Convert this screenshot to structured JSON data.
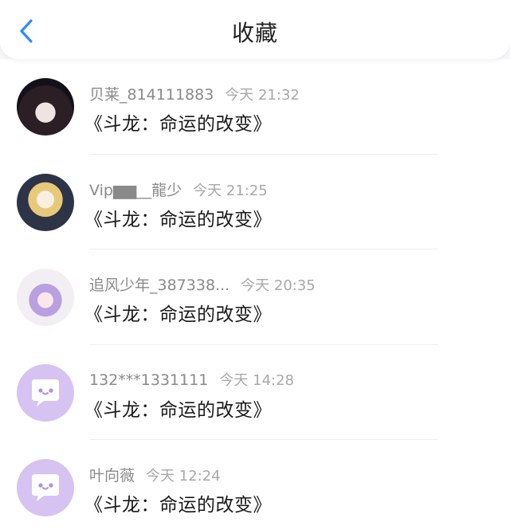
{
  "header": {
    "title": "收藏"
  },
  "items": [
    {
      "username": "贝莱_814111883",
      "time": "今天 21:32",
      "message": "《斗龙：命运的改变》",
      "avatar_icon": "user-avatar-photo"
    },
    {
      "username": "Vip▆▆__龍少",
      "time": "今天 21:25",
      "message": "《斗龙：命运的改变》",
      "avatar_icon": "user-avatar-photo"
    },
    {
      "username": "追风少年_387338...",
      "time": "今天 20:35",
      "message": "《斗龙：命运的改变》",
      "avatar_icon": "user-avatar-photo"
    },
    {
      "username": "132***1331111",
      "time": "今天 14:28",
      "message": "《斗龙：命运的改变》",
      "avatar_icon": "default-chat-bubble-avatar"
    },
    {
      "username": "叶向薇",
      "time": "今天 12:24",
      "message": "《斗龙：命运的改变》",
      "avatar_icon": "default-chat-bubble-avatar"
    }
  ],
  "colors": {
    "accent": "#2f8cff",
    "default_avatar": "#d6c3f1"
  }
}
